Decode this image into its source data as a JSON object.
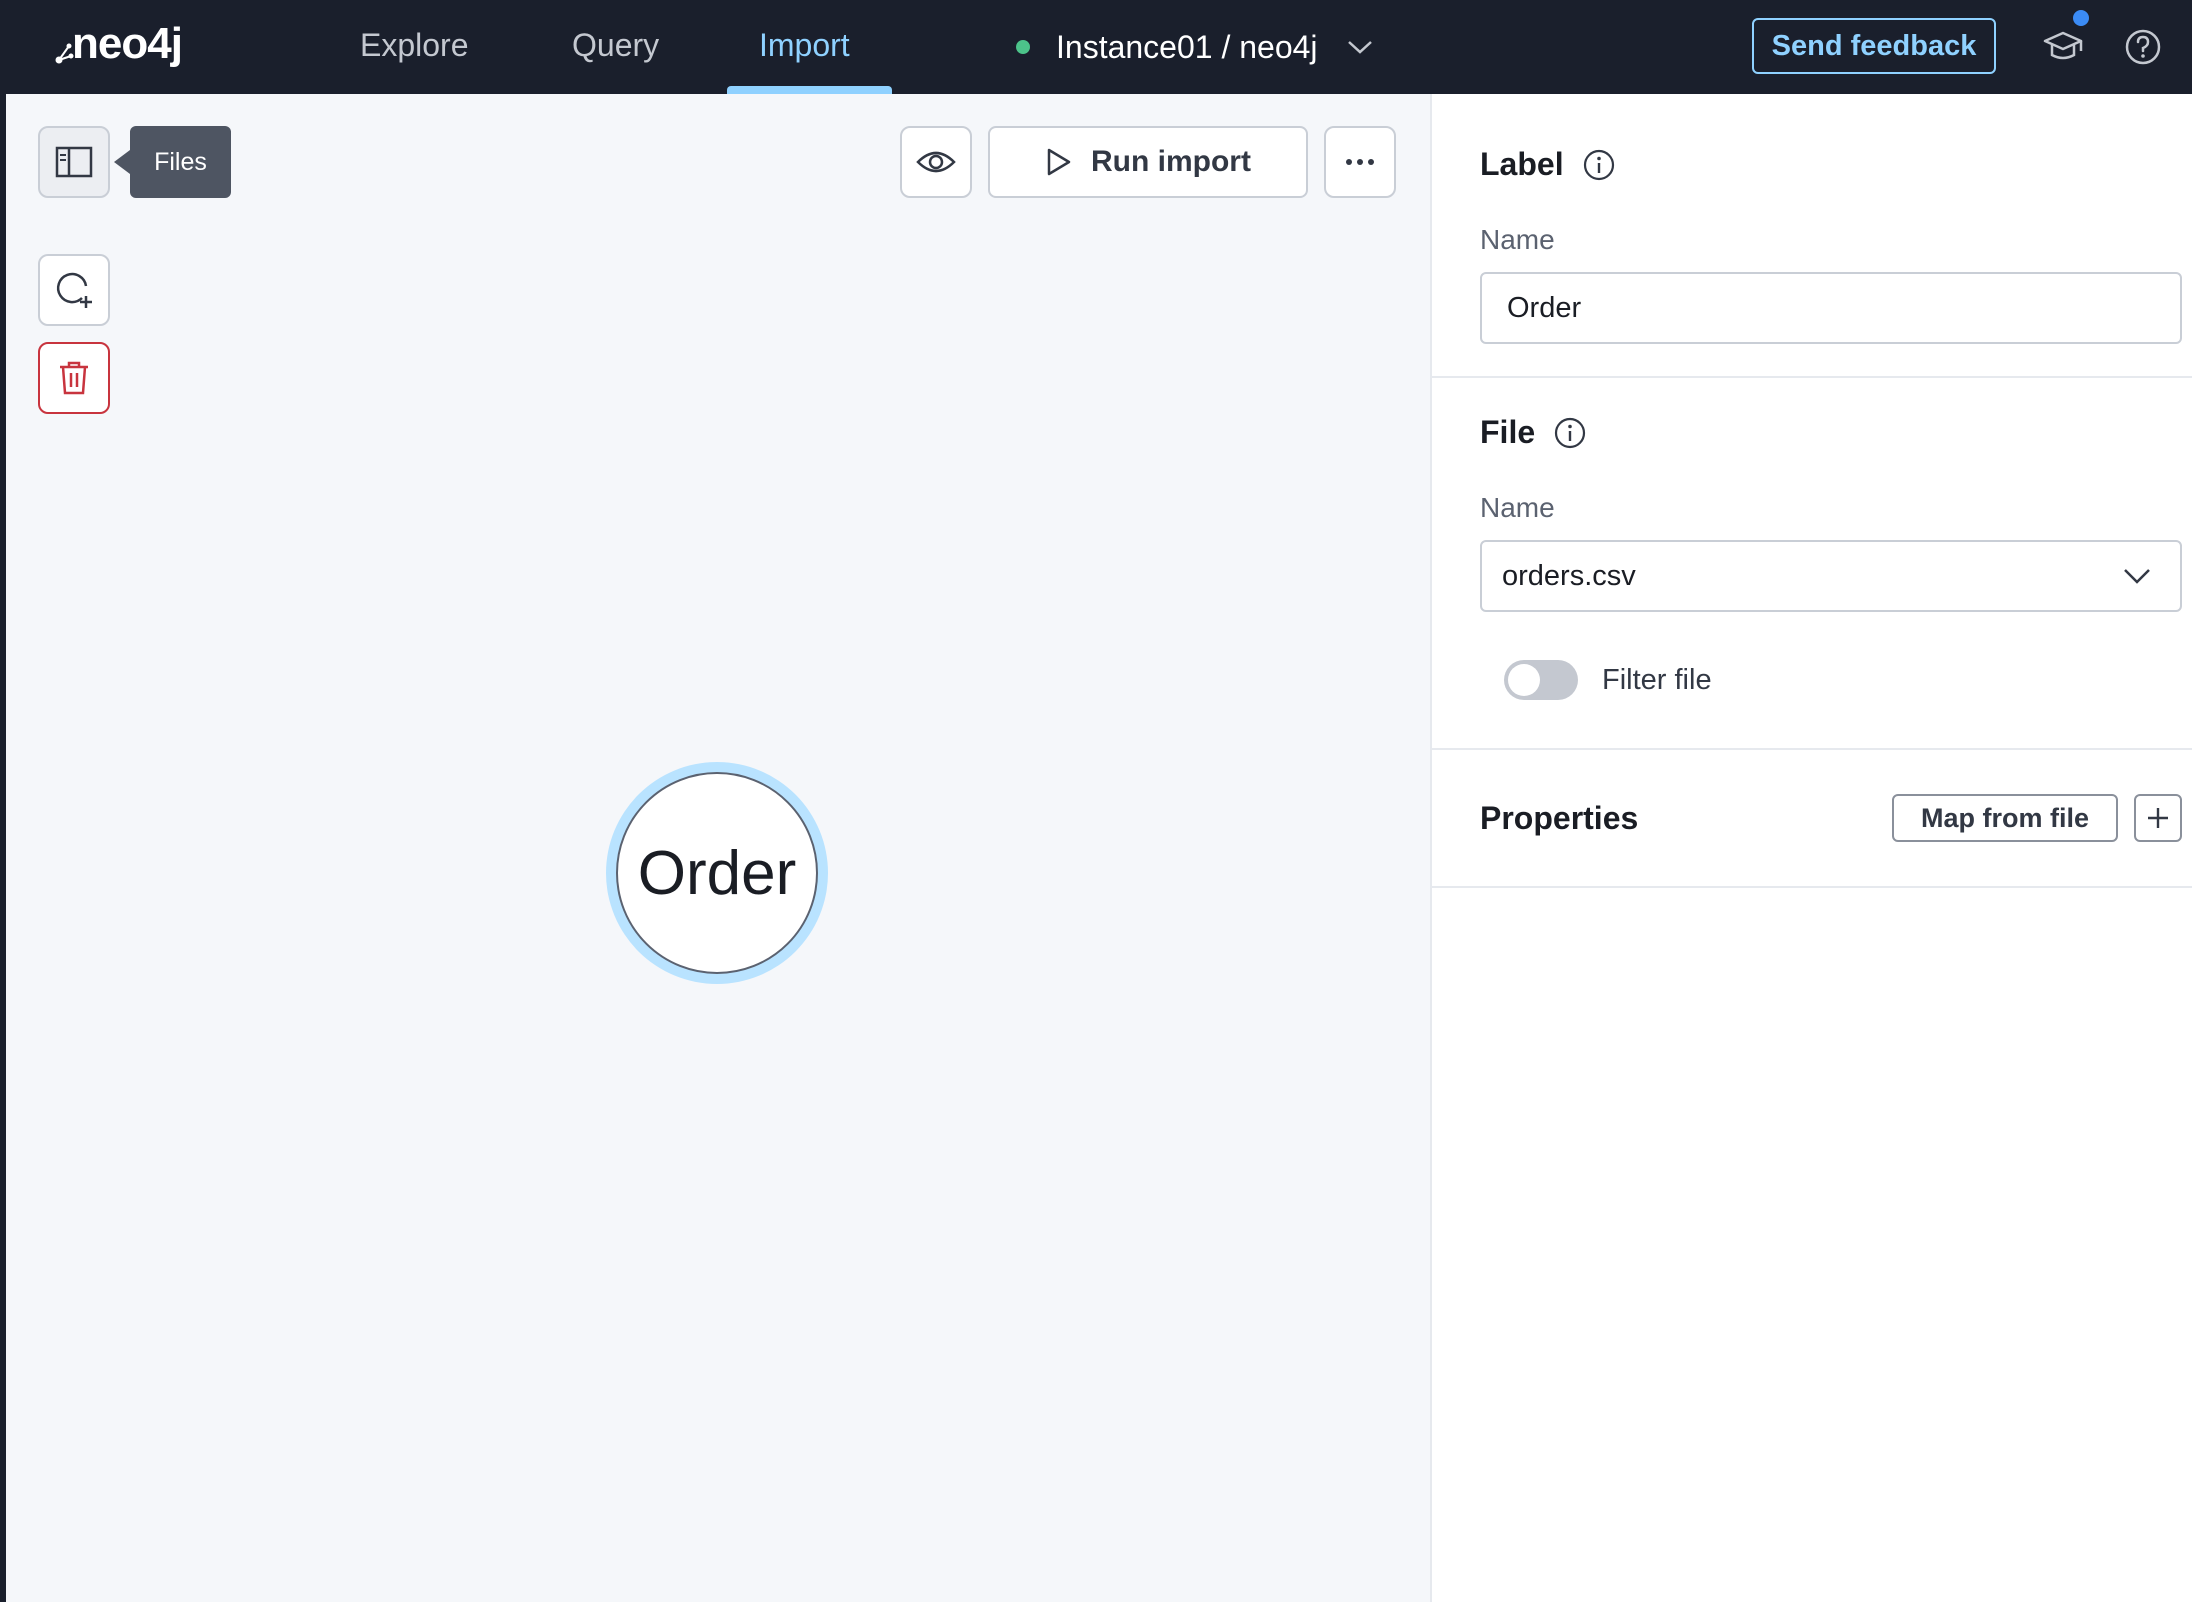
{
  "app": {
    "logo_text": "neo4j"
  },
  "nav": {
    "tabs": [
      {
        "label": "Explore",
        "active": false
      },
      {
        "label": "Query",
        "active": false
      },
      {
        "label": "Import",
        "active": true
      }
    ]
  },
  "instance": {
    "label": "Instance01 / neo4j",
    "status_color": "#4cc38a"
  },
  "header": {
    "feedback_label": "Send feedback",
    "learn_icon": "graduation-cap-icon",
    "help_icon": "help-circle-icon"
  },
  "toolbar": {
    "files_tooltip": "Files",
    "run_import_label": "Run import",
    "preview_icon": "eye-icon",
    "more_icon": "more-horizontal-icon",
    "add_node_icon": "add-node-icon",
    "delete_icon": "trash-icon"
  },
  "canvas": {
    "node_label": "Order",
    "node_highlight_color": "#b9e3ff"
  },
  "panel": {
    "label_section": {
      "title": "Label",
      "name_label": "Name",
      "name_value": "Order"
    },
    "file_section": {
      "title": "File",
      "name_label": "Name",
      "selected_file": "orders.csv",
      "filter_label": "Filter file",
      "filter_enabled": false
    },
    "properties_section": {
      "title": "Properties",
      "map_from_file_label": "Map from file"
    }
  },
  "colors": {
    "topbar": "#1a1f2c",
    "accent": "#8fd1ff",
    "danger": "#c8343e"
  }
}
